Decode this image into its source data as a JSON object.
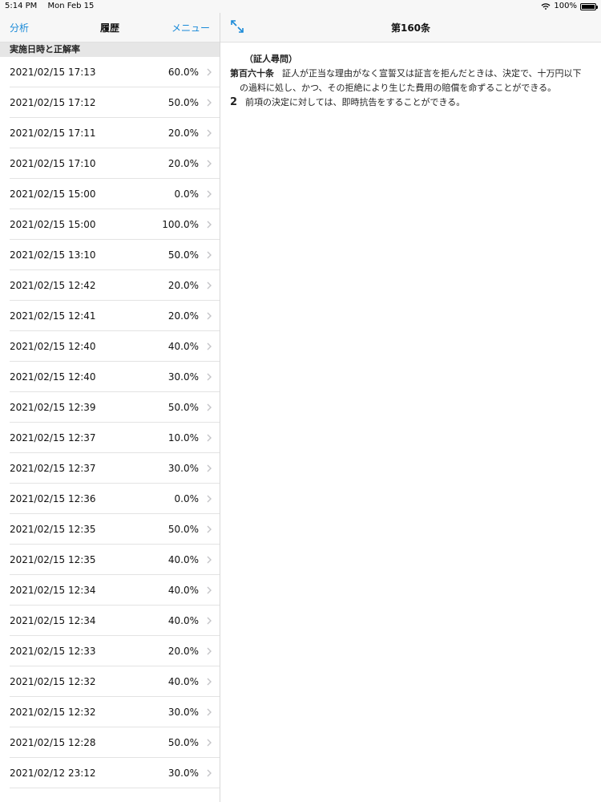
{
  "status_bar": {
    "time": "5:14 PM",
    "date": "Mon Feb 15",
    "battery": "100%"
  },
  "left_nav": {
    "left_label": "分析",
    "title": "履歴",
    "right_label": "メニュー"
  },
  "section_header": "実施日時と正解率",
  "history": [
    {
      "date": "2021/02/15 17:13",
      "rate": "60.0%"
    },
    {
      "date": "2021/02/15 17:12",
      "rate": "50.0%"
    },
    {
      "date": "2021/02/15 17:11",
      "rate": "20.0%"
    },
    {
      "date": "2021/02/15 17:10",
      "rate": "20.0%"
    },
    {
      "date": "2021/02/15 15:00",
      "rate": "0.0%"
    },
    {
      "date": "2021/02/15 15:00",
      "rate": "100.0%"
    },
    {
      "date": "2021/02/15 13:10",
      "rate": "50.0%"
    },
    {
      "date": "2021/02/15 12:42",
      "rate": "20.0%"
    },
    {
      "date": "2021/02/15 12:41",
      "rate": "20.0%"
    },
    {
      "date": "2021/02/15 12:40",
      "rate": "40.0%"
    },
    {
      "date": "2021/02/15 12:40",
      "rate": "30.0%"
    },
    {
      "date": "2021/02/15 12:39",
      "rate": "50.0%"
    },
    {
      "date": "2021/02/15 12:37",
      "rate": "10.0%"
    },
    {
      "date": "2021/02/15 12:37",
      "rate": "30.0%"
    },
    {
      "date": "2021/02/15 12:36",
      "rate": "0.0%"
    },
    {
      "date": "2021/02/15 12:35",
      "rate": "50.0%"
    },
    {
      "date": "2021/02/15 12:35",
      "rate": "40.0%"
    },
    {
      "date": "2021/02/15 12:34",
      "rate": "40.0%"
    },
    {
      "date": "2021/02/15 12:34",
      "rate": "40.0%"
    },
    {
      "date": "2021/02/15 12:33",
      "rate": "20.0%"
    },
    {
      "date": "2021/02/15 12:32",
      "rate": "40.0%"
    },
    {
      "date": "2021/02/15 12:32",
      "rate": "30.0%"
    },
    {
      "date": "2021/02/15 12:28",
      "rate": "50.0%"
    },
    {
      "date": "2021/02/12 23:12",
      "rate": "30.0%"
    }
  ],
  "article": {
    "title": "第160条",
    "caption": "（証人尋問）",
    "number": "第百六十条",
    "text": "証人が正当な理由がなく宣誓又は証言を拒んだときは、決定で、十万円以下の過料に処し、かつ、その拒絶により生じた費用の賠償を命ずることができる。",
    "para2_number": "2",
    "para2_text": "前項の決定に対しては、即時抗告をすることができる。"
  },
  "icons": {
    "expand": "expand-arrows-icon",
    "chevron": "chevron-right-icon",
    "wifi": "wifi-icon",
    "battery": "battery-icon"
  },
  "colors": {
    "accent": "#1a8ad8",
    "nav_bg": "#f7f7f7",
    "section_bg": "#e6e6e6"
  }
}
